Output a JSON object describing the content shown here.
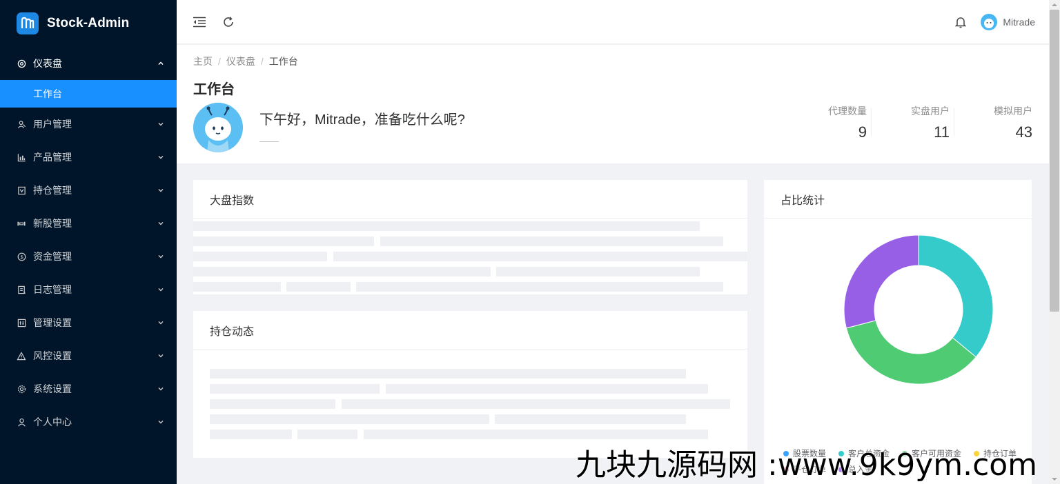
{
  "app": {
    "name": "Stock-Admin",
    "brand_color": "#1890ff"
  },
  "sidebar": {
    "items": [
      {
        "label": "仪表盘",
        "icon": "dashboard-icon",
        "open": true,
        "children": [
          {
            "label": "工作台",
            "active": true
          }
        ]
      },
      {
        "label": "用户管理",
        "icon": "users-icon"
      },
      {
        "label": "产品管理",
        "icon": "chart-icon"
      },
      {
        "label": "持仓管理",
        "icon": "position-icon"
      },
      {
        "label": "新股管理",
        "icon": "ipo-icon"
      },
      {
        "label": "资金管理",
        "icon": "dollar-icon"
      },
      {
        "label": "日志管理",
        "icon": "log-icon"
      },
      {
        "label": "管理设置",
        "icon": "admin-settings-icon"
      },
      {
        "label": "风控设置",
        "icon": "warning-icon"
      },
      {
        "label": "系统设置",
        "icon": "gear-icon"
      },
      {
        "label": "个人中心",
        "icon": "user-icon"
      }
    ]
  },
  "header": {
    "user_name": "Mitrade"
  },
  "breadcrumb": [
    "主页",
    "仪表盘",
    "工作台"
  ],
  "page": {
    "title": "工作台",
    "greeting": "下午好，Mitrade，准备吃什么呢?",
    "sub_greeting": "——"
  },
  "stats": [
    {
      "title": "代理数量",
      "value": "9"
    },
    {
      "title": "实盘用户",
      "value": "11"
    },
    {
      "title": "模拟用户",
      "value": "43"
    }
  ],
  "cards": {
    "market_index": {
      "title": "大盘指数"
    },
    "positions": {
      "title": "持仓动态"
    },
    "ratio": {
      "title": "占比统计"
    }
  },
  "chart_data": {
    "type": "pie",
    "title": "占比统计",
    "series": [
      {
        "name": "股票数量",
        "value": 0,
        "color": "#3aa1ff"
      },
      {
        "name": "客户总资金",
        "value": 36,
        "color": "#36cbcb"
      },
      {
        "name": "客户可用资金",
        "value": 35,
        "color": "#4ecb73"
      },
      {
        "name": "持仓订单",
        "value": 0,
        "color": "#fbd437"
      },
      {
        "name": "平仓订单",
        "value": 0,
        "color": "#f2637b"
      },
      {
        "name": "总入金",
        "value": 29,
        "color": "#975fe5"
      }
    ],
    "legend_position": "bottom"
  },
  "watermark": "九块九源码网 :www.9k9ym.com"
}
